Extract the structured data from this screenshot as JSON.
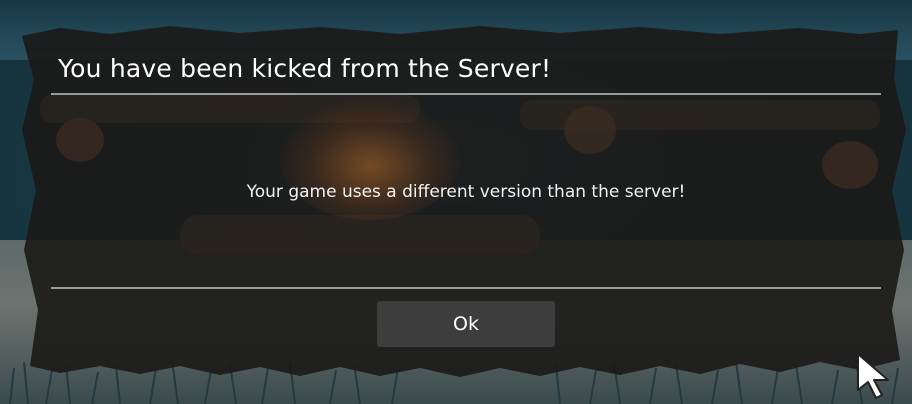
{
  "dialog": {
    "title": "You have been kicked from the Server!",
    "message": "Your game uses a different version than the server!",
    "ok_label": "Ok"
  },
  "colors": {
    "panel": "#1b1917",
    "divider": "#9a9a9a",
    "button_bg": "#3d3d3d",
    "text": "#ffffff"
  },
  "icons": {
    "cursor": "mouse-pointer-icon"
  }
}
